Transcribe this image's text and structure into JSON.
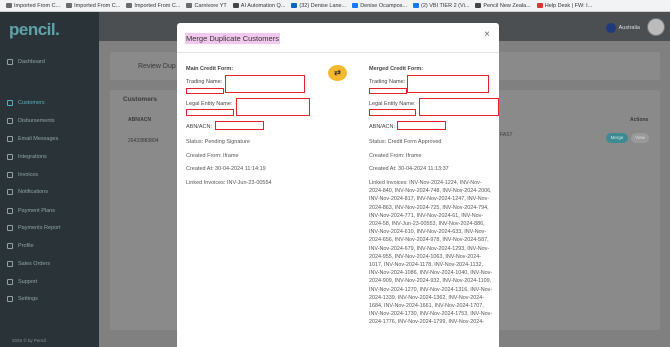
{
  "bookmarks": [
    {
      "label": "Imported From C...",
      "icon": "folder-icon"
    },
    {
      "label": "Imported From C...",
      "icon": "folder-icon"
    },
    {
      "label": "Imported From C...",
      "icon": "folder-icon"
    },
    {
      "label": "Carnivore YT",
      "icon": "folder-icon"
    },
    {
      "label": "AI Automation Q...",
      "icon": "site-icon"
    },
    {
      "label": "(32) Denise Lane...",
      "icon": "linkedin-icon"
    },
    {
      "label": "Denise Ocampos...",
      "icon": "facebook-icon"
    },
    {
      "label": "(2) VBI TIER 2 (Vi...",
      "icon": "facebook-icon"
    },
    {
      "label": "Pencil New Zeala...",
      "icon": "site-icon"
    },
    {
      "label": "Help Desk | FW: I...",
      "icon": "helpdesk-icon"
    }
  ],
  "logo": "pencil.",
  "nav": [
    {
      "label": "Dashboard",
      "icon": "dashboard-icon"
    },
    {
      "label": "Customers",
      "icon": "customers-icon",
      "active": true
    },
    {
      "label": "Disbursements",
      "icon": "disbursements-icon"
    },
    {
      "label": "Email Messages",
      "icon": "email-icon"
    },
    {
      "label": "Integrations",
      "icon": "integrations-icon"
    },
    {
      "label": "Invoices",
      "icon": "invoices-icon"
    },
    {
      "label": "Notifications",
      "icon": "bell-icon"
    },
    {
      "label": "Payment Plans",
      "icon": "payment-plans-icon"
    },
    {
      "label": "Payments Report",
      "icon": "payments-report-icon"
    },
    {
      "label": "Profile",
      "icon": "profile-icon"
    },
    {
      "label": "Sales Orders",
      "icon": "sales-orders-icon"
    },
    {
      "label": "Support",
      "icon": "support-icon"
    },
    {
      "label": "Settings",
      "icon": "settings-icon"
    }
  ],
  "footer": "2025 © by Pencil",
  "topbar": {
    "country": "Australia"
  },
  "background": {
    "page_title": "Review Dup",
    "section_title": "Customers",
    "col_abn": "ABN/ACN",
    "col_actions": "Actions",
    "row_abn": "26433883894",
    "row_fast": "FAST",
    "merge_btn": "Merge",
    "view_btn": "View"
  },
  "modal": {
    "title": "Merge Duplicate Customers",
    "swap_icon": "⇄",
    "main": {
      "heading": "Main Credit Form:",
      "trading_name_label": "Trading Name:",
      "legal_entity_label": "Legal Entity Name:",
      "abn_label": "ABN/ACN:",
      "status": "Status: Pending Signature",
      "created_from": "Created From: Iframe",
      "created_at": "Created At: 30-04-2024 11:14:19",
      "linked_invoices": "Linked Invoices: INV-Jun-23-00554"
    },
    "merged": {
      "heading": "Merged Credit Form:",
      "trading_name_label": "Trading Name:",
      "legal_entity_label": "Legal Entity Name:",
      "abn_label": "ABN/ACN:",
      "status": "Status: Credit Form Approved",
      "created_from": "Created From: Iframe",
      "created_at": "Created At: 30-04-2024 11:13:37",
      "linked_invoices": "Linked Invoices: INV-Nov-2024-1224, INV-Nov-2024-840, INV-Nov-2024-748, INV-Nov-2024-2006, INV-Nov-2024-817, INV-Nov-2024-1247, INV-Nov-2024-863, INV-Nov-2024-725, INV-Nov-2024-794, INV-Nov-2024-771, INV-Nov-2024-61, INV-Nov-2024-58, INV-Jun-23-00553, INV-Nov-2024-886, INV-Nov-2024-610, INV-Nov-2024-633, INV-Nov-2024-656, INV-Nov-2024-978, INV-Nov-2024-587, INV-Nov-2024-679, INV-Nov-2024-1293, INV-Nov-2024-955, INV-Nov-2024-1063, INV-Nov-2024-1017, INV-Nov-2024-1178, INV-Nov-2024-1132, INV-Nov-2024-1086, INV-Nov-2024-1040, INV-Nov-2024-909, INV-Nov-2024-932, INV-Nov-2024-1109, INV-Nov-2024-1270, INV-Nov-2024-1316, INV-Nov-2024-1339, INV-Nov-2024-1362, INV-Nov-2024-1684, INV-Nov-2024-1661, INV-Nov-2024-1707, INV-Nov-2024-1730, INV-Nov-2024-1753, INV-Nov-2024-1776, INV-Nov-2024-1799, INV-Nov-2024-"
    }
  }
}
